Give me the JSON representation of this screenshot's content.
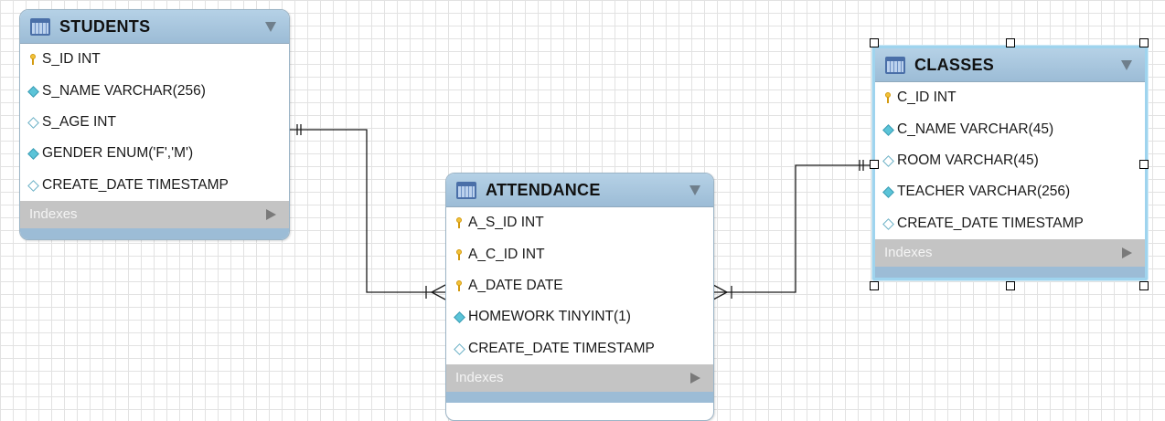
{
  "colors": {
    "header": "#9cbcd6",
    "indexes": "#c4c4c4",
    "key_icon": "#f2c23a",
    "fk_icon": "#5bc4d8",
    "connector": "#1a1a1a",
    "selection": "#9fd4ee"
  },
  "entities": {
    "students": {
      "title": "STUDENTS",
      "columns": [
        {
          "text": "S_ID INT",
          "icon": "primary-key-icon"
        },
        {
          "text": "S_NAME VARCHAR(256)",
          "icon": "filled-diamond-icon"
        },
        {
          "text": "S_AGE INT",
          "icon": "empty-diamond-icon"
        },
        {
          "text": "GENDER ENUM('F','M')",
          "icon": "filled-diamond-icon"
        },
        {
          "text": "CREATE_DATE TIMESTAMP",
          "icon": "empty-diamond-icon"
        }
      ],
      "indexes_label": "Indexes"
    },
    "attendance": {
      "title": "ATTENDANCE",
      "columns": [
        {
          "text": "A_S_ID INT",
          "icon": "primary-key-icon"
        },
        {
          "text": "A_C_ID INT",
          "icon": "primary-key-icon"
        },
        {
          "text": "A_DATE DATE",
          "icon": "primary-key-icon"
        },
        {
          "text": "HOMEWORK TINYINT(1)",
          "icon": "filled-diamond-icon"
        },
        {
          "text": "CREATE_DATE TIMESTAMP",
          "icon": "empty-diamond-icon"
        }
      ],
      "indexes_label": "Indexes"
    },
    "classes": {
      "title": "CLASSES",
      "columns": [
        {
          "text": "C_ID INT",
          "icon": "primary-key-icon"
        },
        {
          "text": "C_NAME VARCHAR(45)",
          "icon": "filled-diamond-icon"
        },
        {
          "text": "ROOM VARCHAR(45)",
          "icon": "empty-diamond-icon"
        },
        {
          "text": "TEACHER VARCHAR(256)",
          "icon": "filled-diamond-icon"
        },
        {
          "text": "CREATE_DATE TIMESTAMP",
          "icon": "empty-diamond-icon"
        }
      ],
      "indexes_label": "Indexes",
      "selected": true
    }
  },
  "relationships": [
    {
      "from": "STUDENTS",
      "to": "ATTENDANCE",
      "from_end": "one-and-only-one",
      "to_end": "one-or-many"
    },
    {
      "from": "CLASSES",
      "to": "ATTENDANCE",
      "from_end": "one-and-only-one",
      "to_end": "one-or-many"
    }
  ]
}
